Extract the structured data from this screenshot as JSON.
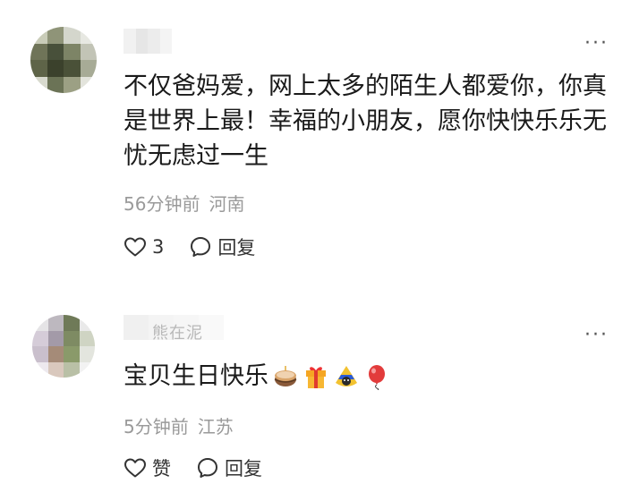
{
  "comments": [
    {
      "text": "不仅爸妈爱，网上太多的陌生人都爱你，你真是世界上最！幸福的小朋友，愿你快快乐乐无忧无虑过一生",
      "time": "56分钟前",
      "location": "河南",
      "like_label": "3",
      "reply_label": "回复"
    },
    {
      "username_partial": "熊在泥",
      "text": "宝贝生日快乐",
      "emojis": [
        "cake-emoji",
        "gift-emoji",
        "party-hat-emoji",
        "balloon-emoji"
      ],
      "time": "5分钟前",
      "location": "江苏",
      "like_label": "赞",
      "reply_label": "回复"
    }
  ],
  "more_icon": "more-dots-icon",
  "colors": {
    "meta": "#9a9a9a",
    "text": "#1a1a1a",
    "icon": "#333333"
  }
}
